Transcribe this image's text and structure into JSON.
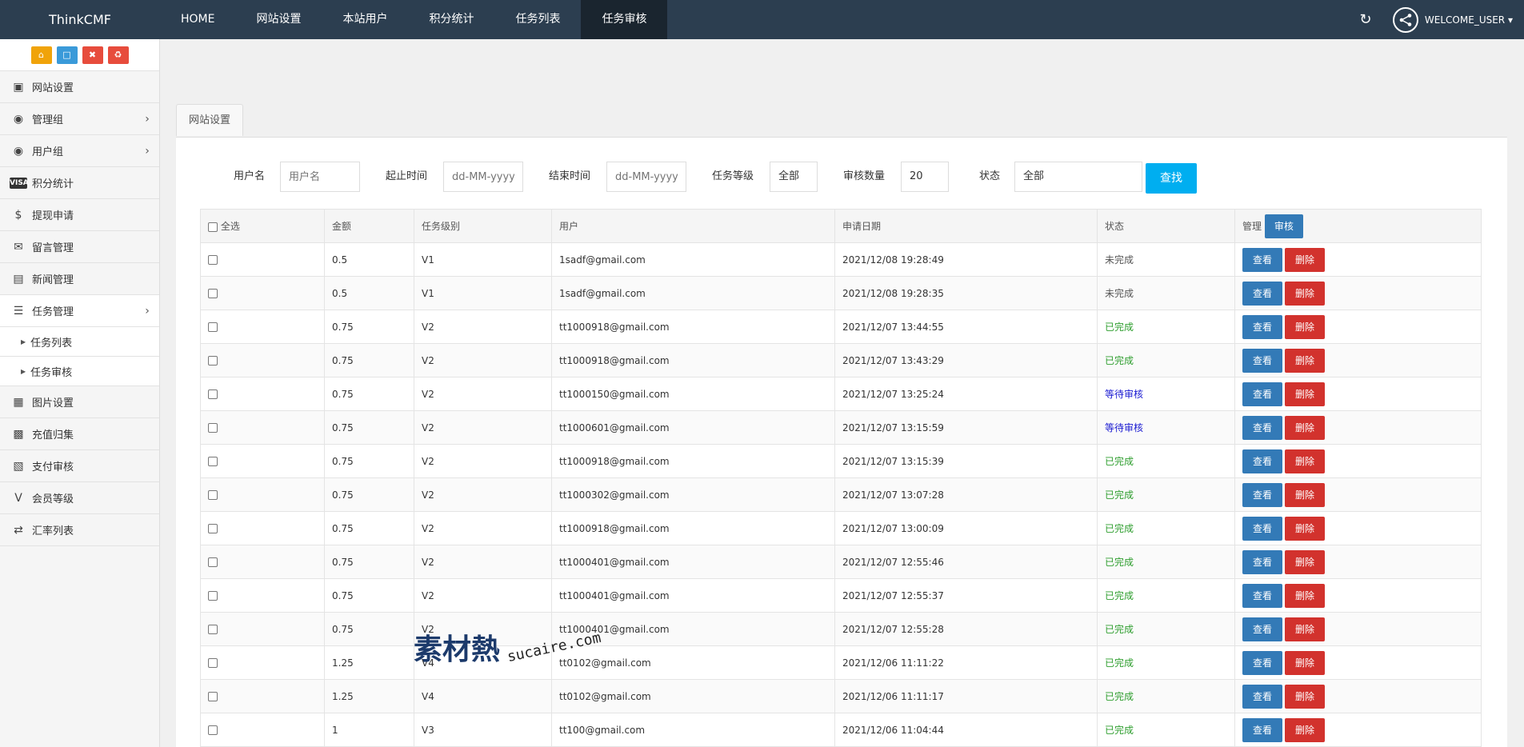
{
  "navbar": {
    "brand": "ThinkCMF",
    "items": [
      "HOME",
      "网站设置",
      "本站用户",
      "积分统计",
      "任务列表",
      "任务审核"
    ],
    "active_index": 5,
    "user": "WELCOME_USER"
  },
  "sidebar": {
    "items": [
      {
        "label": "网站设置",
        "icon": "monitor-icon"
      },
      {
        "label": "管理组",
        "icon": "user-circle-icon",
        "chevron": true
      },
      {
        "label": "用户组",
        "icon": "user-circle-icon",
        "chevron": true
      },
      {
        "label": "积分统计",
        "icon": "visa-icon"
      },
      {
        "label": "提现申请",
        "icon": "dollar-icon"
      },
      {
        "label": "留言管理",
        "icon": "envelope-icon"
      },
      {
        "label": "新闻管理",
        "icon": "newspaper-icon"
      },
      {
        "label": "任务管理",
        "icon": "tasks-icon",
        "chevron": true
      },
      {
        "label": "任务列表",
        "sub": true
      },
      {
        "label": "任务审核",
        "sub": true
      },
      {
        "label": "图片设置",
        "icon": "image-icon"
      },
      {
        "label": "充值归集",
        "icon": "money-icon"
      },
      {
        "label": "支付审核",
        "icon": "id-card-icon"
      },
      {
        "label": "会员等级",
        "icon": "vine-icon"
      },
      {
        "label": "汇率列表",
        "icon": "exchange-icon"
      }
    ]
  },
  "tab": {
    "label": "网站设置"
  },
  "filters": {
    "username_label": "用户名",
    "username_placeholder": "用户名",
    "start_label": "起止时间",
    "start_placeholder": "dd-MM-yyyy",
    "end_label": "结束时间",
    "end_placeholder": "dd-MM-yyyy",
    "level_label": "任务等级",
    "level_value": "全部",
    "count_label": "审核数量",
    "count_value": "20",
    "status_label": "状态",
    "status_value": "全部",
    "search_label": "查找"
  },
  "table": {
    "headers": {
      "select_all": "全选",
      "amount": "金额",
      "level": "任务级别",
      "user": "用户",
      "date": "申请日期",
      "status": "状态",
      "manage": "管理",
      "review": "审核"
    },
    "view_label": "查看",
    "delete_label": "删除",
    "rows": [
      {
        "amount": "0.5",
        "level": "V1",
        "user": "1sadf@gmail.com",
        "date": "2021/12/08 19:28:49",
        "status": "未完成",
        "status_type": "no"
      },
      {
        "amount": "0.5",
        "level": "V1",
        "user": "1sadf@gmail.com",
        "date": "2021/12/08 19:28:35",
        "status": "未完成",
        "status_type": "no"
      },
      {
        "amount": "0.75",
        "level": "V2",
        "user": "tt1000918@gmail.com",
        "date": "2021/12/07 13:44:55",
        "status": "已完成",
        "status_type": "done"
      },
      {
        "amount": "0.75",
        "level": "V2",
        "user": "tt1000918@gmail.com",
        "date": "2021/12/07 13:43:29",
        "status": "已完成",
        "status_type": "done"
      },
      {
        "amount": "0.75",
        "level": "V2",
        "user": "tt1000150@gmail.com",
        "date": "2021/12/07 13:25:24",
        "status": "等待审核",
        "status_type": "wait"
      },
      {
        "amount": "0.75",
        "level": "V2",
        "user": "tt1000601@gmail.com",
        "date": "2021/12/07 13:15:59",
        "status": "等待审核",
        "status_type": "wait"
      },
      {
        "amount": "0.75",
        "level": "V2",
        "user": "tt1000918@gmail.com",
        "date": "2021/12/07 13:15:39",
        "status": "已完成",
        "status_type": "done"
      },
      {
        "amount": "0.75",
        "level": "V2",
        "user": "tt1000302@gmail.com",
        "date": "2021/12/07 13:07:28",
        "status": "已完成",
        "status_type": "done"
      },
      {
        "amount": "0.75",
        "level": "V2",
        "user": "tt1000918@gmail.com",
        "date": "2021/12/07 13:00:09",
        "status": "已完成",
        "status_type": "done"
      },
      {
        "amount": "0.75",
        "level": "V2",
        "user": "tt1000401@gmail.com",
        "date": "2021/12/07 12:55:46",
        "status": "已完成",
        "status_type": "done"
      },
      {
        "amount": "0.75",
        "level": "V2",
        "user": "tt1000401@gmail.com",
        "date": "2021/12/07 12:55:37",
        "status": "已完成",
        "status_type": "done"
      },
      {
        "amount": "0.75",
        "level": "V2",
        "user": "tt1000401@gmail.com",
        "date": "2021/12/07 12:55:28",
        "status": "已完成",
        "status_type": "done"
      },
      {
        "amount": "1.25",
        "level": "V4",
        "user": "tt0102@gmail.com",
        "date": "2021/12/06 11:11:22",
        "status": "已完成",
        "status_type": "done"
      },
      {
        "amount": "1.25",
        "level": "V4",
        "user": "tt0102@gmail.com",
        "date": "2021/12/06 11:11:17",
        "status": "已完成",
        "status_type": "done"
      },
      {
        "amount": "1",
        "level": "V3",
        "user": "tt100@gmail.com",
        "date": "2021/12/06 11:04:44",
        "status": "已完成",
        "status_type": "done"
      }
    ]
  },
  "watermark": {
    "logo": "素材熱",
    "text": "sucaire.com"
  }
}
